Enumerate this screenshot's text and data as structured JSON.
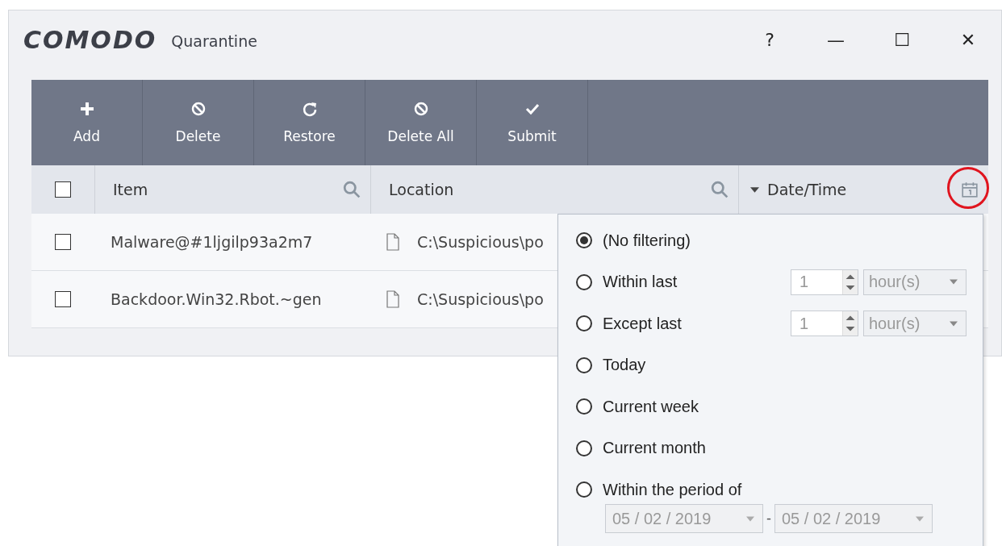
{
  "window": {
    "logo": "COMODO",
    "title": "Quarantine",
    "controls": [
      "?",
      "—",
      "☐",
      "✕"
    ]
  },
  "toolbar": [
    {
      "label": "Add"
    },
    {
      "label": "Delete"
    },
    {
      "label": "Restore"
    },
    {
      "label": "Delete All"
    },
    {
      "label": "Submit"
    }
  ],
  "table": {
    "select_all": {
      "checked": false
    },
    "columns": [
      {
        "label": "Item"
      },
      {
        "label": "Location"
      },
      {
        "label": "Date/Time"
      }
    ],
    "date_filter_highlighted": true,
    "rows": [
      {
        "checked": false,
        "item": "Malware@#1ljgilp93a2m7",
        "location": "C:\\Suspicious\\po"
      },
      {
        "checked": false,
        "item": "Backdoor.Win32.Rbot.~gen",
        "location": "C:\\Suspicious\\po"
      }
    ]
  },
  "date_filter": {
    "options": [
      {
        "kind": "plain",
        "label": "(No filtering)",
        "selected": true
      },
      {
        "kind": "spinner",
        "label": "Within last",
        "value": "1",
        "unit": "hour(s)",
        "selected": false
      },
      {
        "kind": "spinner",
        "label": "Except last",
        "value": "1",
        "unit": "hour(s)",
        "selected": false
      },
      {
        "kind": "plain",
        "label": "Today",
        "selected": false
      },
      {
        "kind": "plain",
        "label": "Current week",
        "selected": false
      },
      {
        "kind": "plain",
        "label": "Current month",
        "selected": false
      },
      {
        "kind": "period",
        "label": "Within the period of",
        "from": "05 / 02 / 2019",
        "separator": "-",
        "to": "05 / 02 / 2019",
        "selected": false
      }
    ]
  }
}
